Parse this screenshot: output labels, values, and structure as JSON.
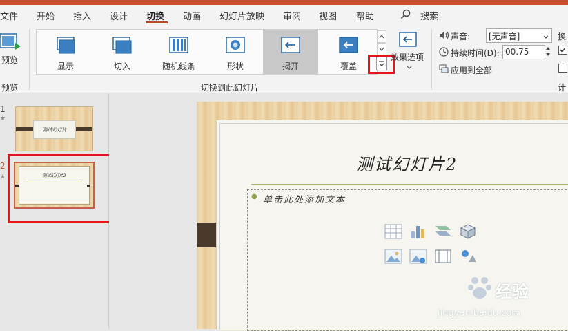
{
  "menu": {
    "items": [
      "文件",
      "开始",
      "插入",
      "设计",
      "切换",
      "动画",
      "幻灯片放映",
      "审阅",
      "视图",
      "帮助"
    ],
    "search_label": "搜索"
  },
  "ribbon": {
    "preview": {
      "label": "预览",
      "group_label": "预览"
    },
    "gallery_items": [
      "显示",
      "切入",
      "随机线条",
      "形状",
      "揭开",
      "覆盖"
    ],
    "selected_item": "揭开",
    "effect_options_label": "效果选项",
    "group_label": "切换到此幻灯片",
    "sound_label": "声音:",
    "sound_value": "[无声音]",
    "duration_label": "持续时间(D):",
    "duration_value": "00.75",
    "apply_all_label": "应用到全部",
    "right_label_top": "换",
    "right_label_bottom": "计"
  },
  "thumbnails": [
    {
      "number": "1",
      "title": "测试幻灯片"
    },
    {
      "number": "2",
      "title": "测试幻灯片2"
    }
  ],
  "slide": {
    "title": "测试幻灯片2",
    "body_placeholder": "单击此处添加文本"
  },
  "watermark": {
    "text": "经验",
    "url": "jingyan.baidu.com"
  },
  "colors": {
    "accent": "#b7472a",
    "highlight": "#e8141c",
    "title_bar": "#c94f2e"
  }
}
